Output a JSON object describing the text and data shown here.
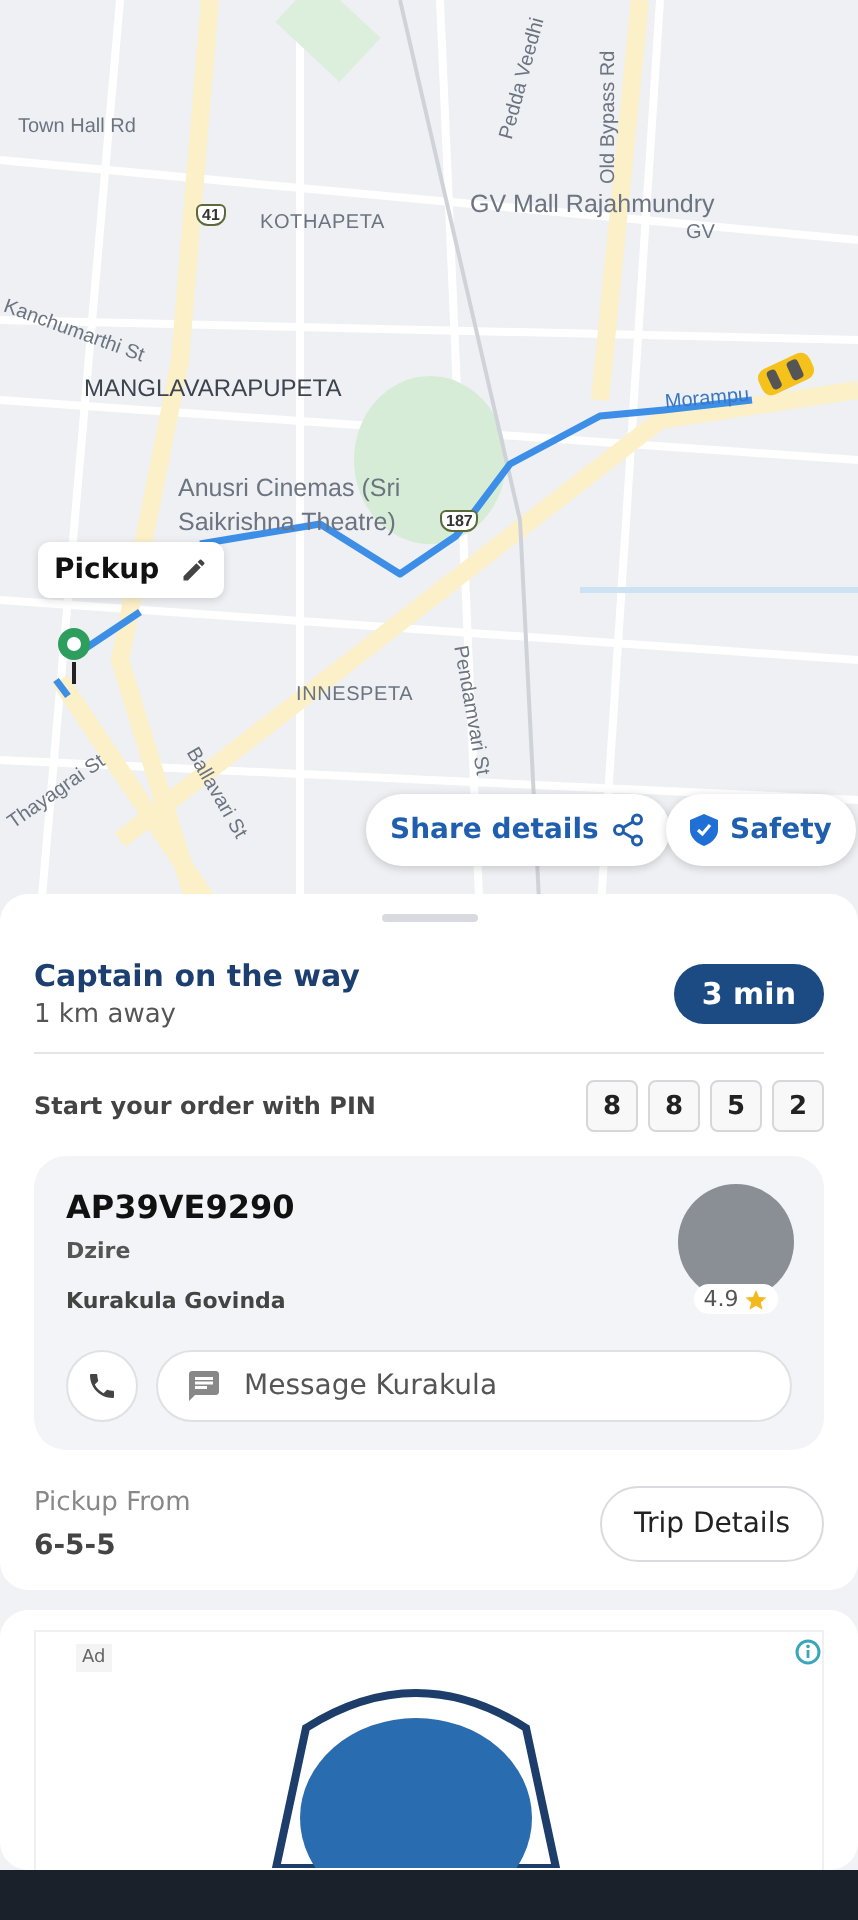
{
  "map": {
    "labels": [
      {
        "text": "Town Hall Rd",
        "kind": "street"
      },
      {
        "text": "41",
        "kind": "shield"
      },
      {
        "text": "KOTHAPETA",
        "kind": "area"
      },
      {
        "text": "Pedda Veedhi",
        "kind": "street"
      },
      {
        "text": "Old Bypass Rd",
        "kind": "street"
      },
      {
        "text": "GV Mall Rajahmundry",
        "kind": "place"
      },
      {
        "text": "GV",
        "kind": "street"
      },
      {
        "text": "Kanchumarthi St",
        "kind": "street"
      },
      {
        "text": "MANGLAVARAPUPETA",
        "kind": "district"
      },
      {
        "text": "Morampu",
        "kind": "route"
      },
      {
        "text": "Anusri Cinemas (Sri",
        "kind": "place"
      },
      {
        "text": "Saikrishna Theatre)",
        "kind": "place"
      },
      {
        "text": "187",
        "kind": "shield"
      },
      {
        "text": "INNESPETA",
        "kind": "area"
      },
      {
        "text": "Pendamvari St",
        "kind": "street"
      },
      {
        "text": "Ballavari St",
        "kind": "street"
      },
      {
        "text": "Thayagrai St",
        "kind": "street"
      }
    ],
    "pickup_label": "Pickup",
    "share_button": "Share details",
    "safety_button": "Safety"
  },
  "status": {
    "title": "Captain on the way",
    "distance": "1 km away",
    "eta": "3 min"
  },
  "pin": {
    "label": "Start your order with PIN",
    "digits": [
      "8",
      "8",
      "5",
      "2"
    ]
  },
  "captain": {
    "plate": "AP39VE9290",
    "car": "Dzire",
    "name": "Kurakula Govinda",
    "rating": "4.9",
    "message_placeholder": "Message Kurakula"
  },
  "pickup": {
    "label": "Pickup From",
    "address": "6-5-5",
    "button": "Trip Details"
  },
  "ad": {
    "label": "Ad"
  }
}
